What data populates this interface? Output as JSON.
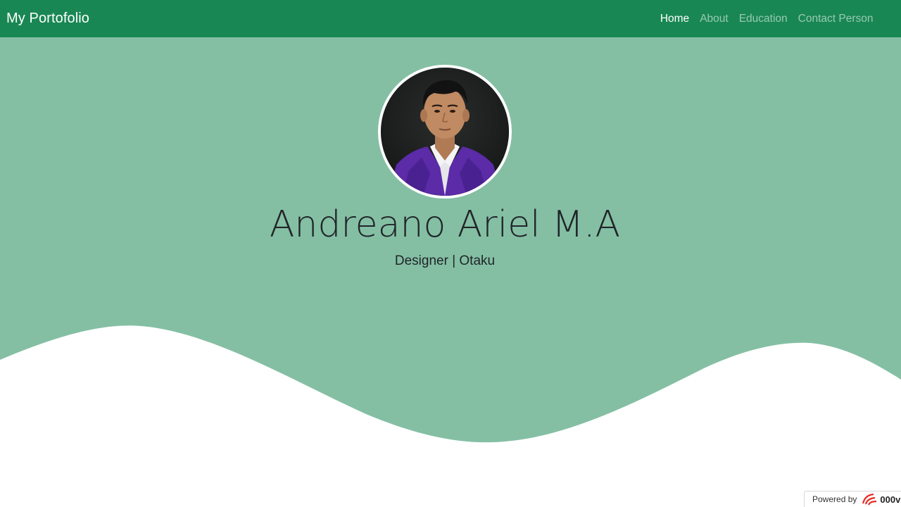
{
  "navbar": {
    "brand": "My Portofolio",
    "links": [
      {
        "label": "Home",
        "active": true
      },
      {
        "label": "About",
        "active": false
      },
      {
        "label": "Education",
        "active": false
      },
      {
        "label": "Contact Person",
        "active": false
      }
    ]
  },
  "hero": {
    "name": "Andreano Ariel M.A",
    "tagline": "Designer | Otaku",
    "avatar_icon": "profile-photo"
  },
  "footer_badge": {
    "prefix": "Powered by",
    "brand": "000v",
    "icon": "000webhost-logo-icon"
  },
  "colors": {
    "navbar": "#198754",
    "hero_background": "#84bfa4",
    "wave": "#ffffff",
    "text": "#212529"
  }
}
